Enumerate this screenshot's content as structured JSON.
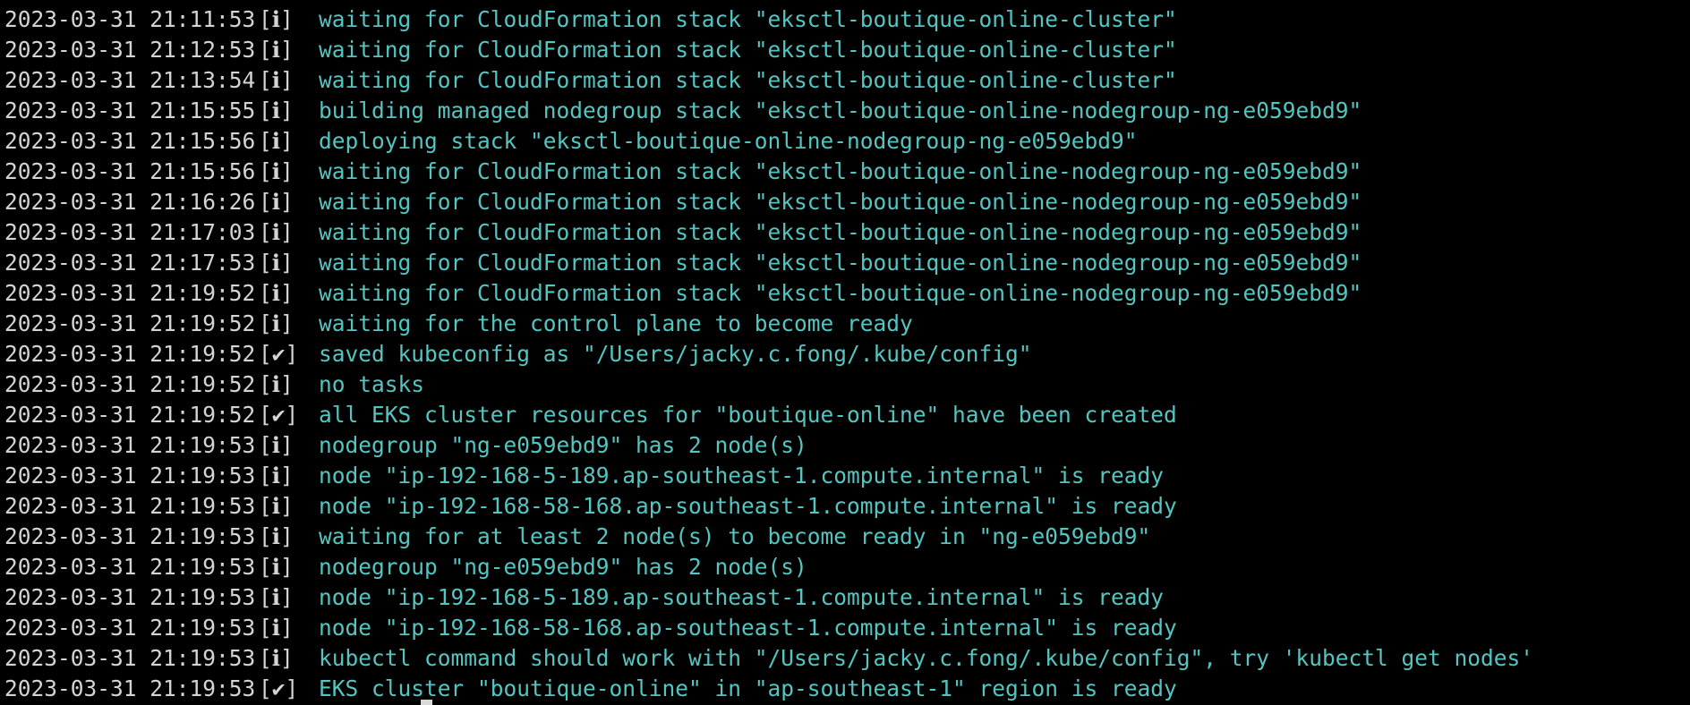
{
  "colors": {
    "background": "#000000",
    "timestamp": "#d4d4d4",
    "message": "#54c5c0"
  },
  "log": [
    {
      "ts": "2023-03-31 21:11:53",
      "badge": "[ℹ]",
      "msg": "waiting for CloudFormation stack \"eksctl-boutique-online-cluster\""
    },
    {
      "ts": "2023-03-31 21:12:53",
      "badge": "[ℹ]",
      "msg": "waiting for CloudFormation stack \"eksctl-boutique-online-cluster\""
    },
    {
      "ts": "2023-03-31 21:13:54",
      "badge": "[ℹ]",
      "msg": "waiting for CloudFormation stack \"eksctl-boutique-online-cluster\""
    },
    {
      "ts": "2023-03-31 21:15:55",
      "badge": "[ℹ]",
      "msg": "building managed nodegroup stack \"eksctl-boutique-online-nodegroup-ng-e059ebd9\""
    },
    {
      "ts": "2023-03-31 21:15:56",
      "badge": "[ℹ]",
      "msg": "deploying stack \"eksctl-boutique-online-nodegroup-ng-e059ebd9\""
    },
    {
      "ts": "2023-03-31 21:15:56",
      "badge": "[ℹ]",
      "msg": "waiting for CloudFormation stack \"eksctl-boutique-online-nodegroup-ng-e059ebd9\""
    },
    {
      "ts": "2023-03-31 21:16:26",
      "badge": "[ℹ]",
      "msg": "waiting for CloudFormation stack \"eksctl-boutique-online-nodegroup-ng-e059ebd9\""
    },
    {
      "ts": "2023-03-31 21:17:03",
      "badge": "[ℹ]",
      "msg": "waiting for CloudFormation stack \"eksctl-boutique-online-nodegroup-ng-e059ebd9\""
    },
    {
      "ts": "2023-03-31 21:17:53",
      "badge": "[ℹ]",
      "msg": "waiting for CloudFormation stack \"eksctl-boutique-online-nodegroup-ng-e059ebd9\""
    },
    {
      "ts": "2023-03-31 21:19:52",
      "badge": "[ℹ]",
      "msg": "waiting for CloudFormation stack \"eksctl-boutique-online-nodegroup-ng-e059ebd9\""
    },
    {
      "ts": "2023-03-31 21:19:52",
      "badge": "[ℹ]",
      "msg": "waiting for the control plane to become ready"
    },
    {
      "ts": "2023-03-31 21:19:52",
      "badge": "[✔]",
      "msg": "saved kubeconfig as \"/Users/jacky.c.fong/.kube/config\""
    },
    {
      "ts": "2023-03-31 21:19:52",
      "badge": "[ℹ]",
      "msg": "no tasks"
    },
    {
      "ts": "2023-03-31 21:19:52",
      "badge": "[✔]",
      "msg": "all EKS cluster resources for \"boutique-online\" have been created"
    },
    {
      "ts": "2023-03-31 21:19:53",
      "badge": "[ℹ]",
      "msg": "nodegroup \"ng-e059ebd9\" has 2 node(s)"
    },
    {
      "ts": "2023-03-31 21:19:53",
      "badge": "[ℹ]",
      "msg": "node \"ip-192-168-5-189.ap-southeast-1.compute.internal\" is ready"
    },
    {
      "ts": "2023-03-31 21:19:53",
      "badge": "[ℹ]",
      "msg": "node \"ip-192-168-58-168.ap-southeast-1.compute.internal\" is ready"
    },
    {
      "ts": "2023-03-31 21:19:53",
      "badge": "[ℹ]",
      "msg": "waiting for at least 2 node(s) to become ready in \"ng-e059ebd9\""
    },
    {
      "ts": "2023-03-31 21:19:53",
      "badge": "[ℹ]",
      "msg": "nodegroup \"ng-e059ebd9\" has 2 node(s)"
    },
    {
      "ts": "2023-03-31 21:19:53",
      "badge": "[ℹ]",
      "msg": "node \"ip-192-168-5-189.ap-southeast-1.compute.internal\" is ready"
    },
    {
      "ts": "2023-03-31 21:19:53",
      "badge": "[ℹ]",
      "msg": "node \"ip-192-168-58-168.ap-southeast-1.compute.internal\" is ready"
    },
    {
      "ts": "2023-03-31 21:19:53",
      "badge": "[ℹ]",
      "msg": "kubectl command should work with \"/Users/jacky.c.fong/.kube/config\", try 'kubectl get nodes'"
    },
    {
      "ts": "2023-03-31 21:19:53",
      "badge": "[✔]",
      "msg": "EKS cluster \"boutique-online\" in \"ap-southeast-1\" region is ready"
    }
  ]
}
